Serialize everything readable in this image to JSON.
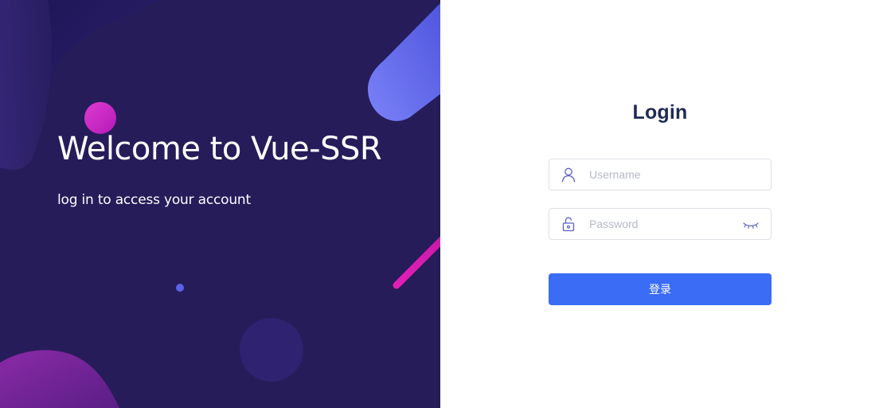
{
  "welcome": {
    "title": "Welcome to Vue-SSR",
    "subtitle": "log in to access your account",
    "background_color": "#261c5a"
  },
  "login": {
    "title": "Login",
    "username": {
      "placeholder": "Username",
      "value": "",
      "icon": "user-icon"
    },
    "password": {
      "placeholder": "Password",
      "value": "",
      "icon": "unlock-icon",
      "toggle_icon": "eye-closed-icon"
    },
    "submit_label": "登录",
    "accent_color": "#3a6cf6",
    "title_color": "#1f2a56"
  }
}
